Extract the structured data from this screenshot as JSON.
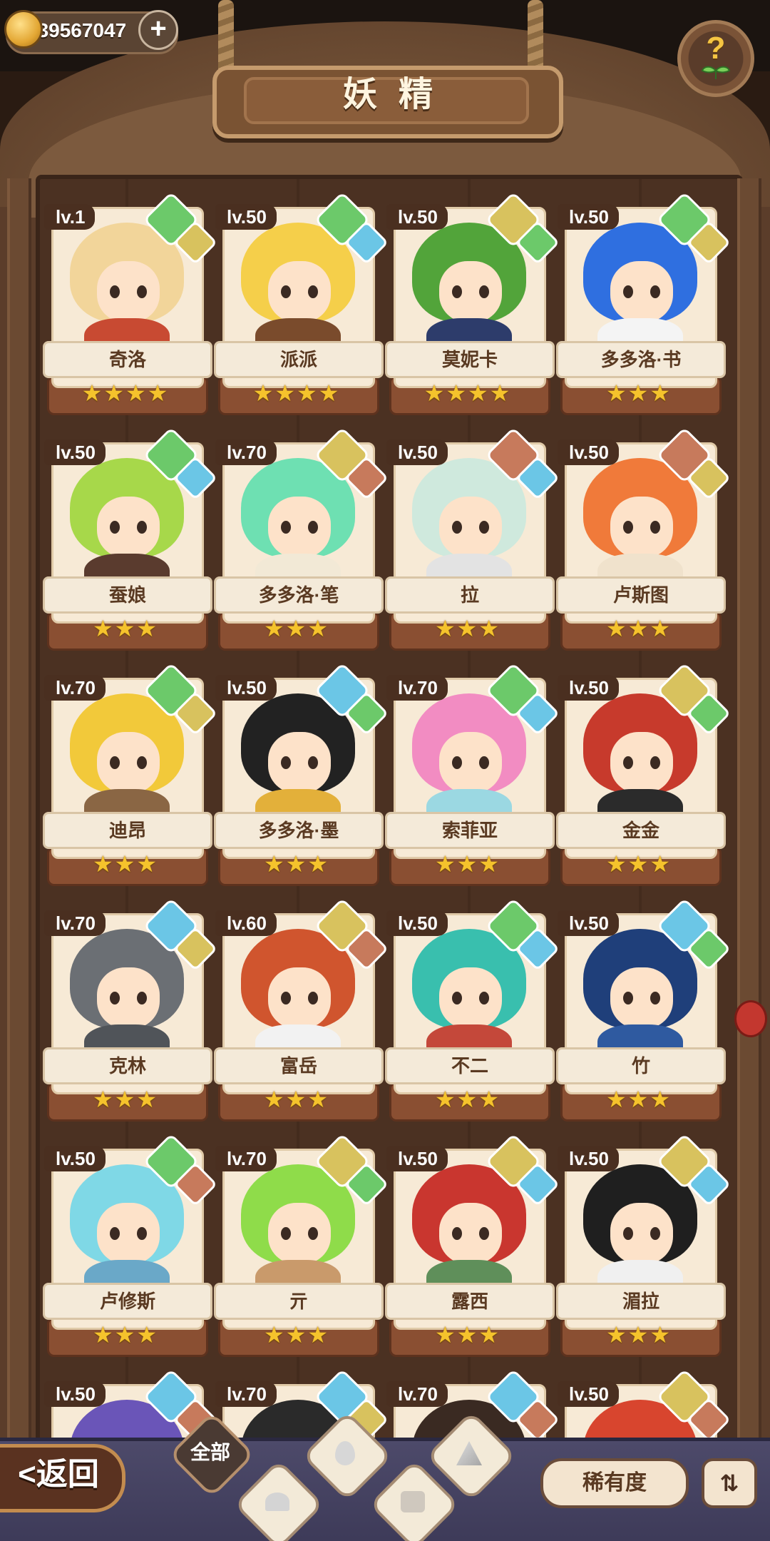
{
  "currency": {
    "amount": "239567047",
    "add_label": "+"
  },
  "help": {
    "label": "?"
  },
  "header": {
    "title": "妖精"
  },
  "cards": [
    {
      "level": "lv.1",
      "name": "奇洛",
      "stars": "★★★★",
      "hair": "#f2d59a",
      "body": "#c84a32",
      "elem1": "green",
      "elem2": "earth"
    },
    {
      "level": "lv.50",
      "name": "派派",
      "stars": "★★★★",
      "hair": "#f5cf4a",
      "body": "#7a4b2c",
      "elem1": "green",
      "elem2": "water"
    },
    {
      "level": "lv.50",
      "name": "莫妮卡",
      "stars": "★★★★",
      "hair": "#52a43a",
      "body": "#2d3c6b",
      "elem1": "earth",
      "elem2": "green"
    },
    {
      "level": "lv.50",
      "name": "多多洛·书",
      "stars": "★★★",
      "hair": "#2f6fe0",
      "body": "#f4f4f4",
      "elem1": "green",
      "elem2": "earth"
    },
    {
      "level": "lv.50",
      "name": "蚕娘",
      "stars": "★★★",
      "hair": "#a7d84a",
      "body": "#5a3b2e",
      "elem1": "green",
      "elem2": "water"
    },
    {
      "level": "lv.70",
      "name": "多多洛·笔",
      "stars": "★★★",
      "hair": "#6ee0b2",
      "body": "#f2e9d6",
      "elem1": "earth",
      "elem2": "fire"
    },
    {
      "level": "lv.50",
      "name": "拉",
      "stars": "★★★",
      "hair": "#cfe9dd",
      "body": "#e3e3e3",
      "elem1": "fire",
      "elem2": "water"
    },
    {
      "level": "lv.50",
      "name": "卢斯图",
      "stars": "★★★",
      "hair": "#f07a3a",
      "body": "#f0e2cc",
      "elem1": "fire",
      "elem2": "earth"
    },
    {
      "level": "lv.70",
      "name": "迪昂",
      "stars": "★★★",
      "hair": "#f2c93a",
      "body": "#8a6644",
      "elem1": "green",
      "elem2": "earth"
    },
    {
      "level": "lv.50",
      "name": "多多洛·墨",
      "stars": "★★★",
      "hair": "#222222",
      "body": "#e3b03a",
      "elem1": "water",
      "elem2": "green"
    },
    {
      "level": "lv.70",
      "name": "索菲亚",
      "stars": "★★★",
      "hair": "#f28cc2",
      "body": "#9bd8e2",
      "elem1": "green",
      "elem2": "water"
    },
    {
      "level": "lv.50",
      "name": "金金",
      "stars": "★★★",
      "hair": "#c73a2c",
      "body": "#2b2b2b",
      "elem1": "earth",
      "elem2": "green"
    },
    {
      "level": "lv.70",
      "name": "克林",
      "stars": "★★★",
      "hair": "#6b6f74",
      "body": "#505459",
      "elem1": "water",
      "elem2": "earth"
    },
    {
      "level": "lv.60",
      "name": "富岳",
      "stars": "★★★",
      "hair": "#d0552e",
      "body": "#f2f2f2",
      "elem1": "earth",
      "elem2": "fire"
    },
    {
      "level": "lv.50",
      "name": "不二",
      "stars": "★★★",
      "hair": "#39bfae",
      "body": "#c4483a",
      "elem1": "green",
      "elem2": "water"
    },
    {
      "level": "lv.50",
      "name": "竹",
      "stars": "★★★",
      "hair": "#1f3f7a",
      "body": "#2f5aa0",
      "elem1": "water",
      "elem2": "green"
    },
    {
      "level": "lv.50",
      "name": "卢修斯",
      "stars": "★★★",
      "hair": "#7fd8e6",
      "body": "#6aa8c8",
      "elem1": "green",
      "elem2": "fire"
    },
    {
      "level": "lv.70",
      "name": "亓",
      "stars": "★★★",
      "hair": "#8fdc4a",
      "body": "#c99a6b",
      "elem1": "earth",
      "elem2": "green"
    },
    {
      "level": "lv.50",
      "name": "露西",
      "stars": "★★★",
      "hair": "#c9362f",
      "body": "#5f8f5a",
      "elem1": "earth",
      "elem2": "water"
    },
    {
      "level": "lv.50",
      "name": "湄拉",
      "stars": "★★★",
      "hair": "#1f1f1f",
      "body": "#f0f0f0",
      "elem1": "earth",
      "elem2": "water"
    },
    {
      "level": "lv.50",
      "name": "",
      "stars": "",
      "hair": "#6a55b8",
      "body": "#6a55b8",
      "elem1": "water",
      "elem2": "fire"
    },
    {
      "level": "lv.70",
      "name": "",
      "stars": "",
      "hair": "#2a2a2a",
      "body": "#2a2a2a",
      "elem1": "water",
      "elem2": "earth"
    },
    {
      "level": "lv.70",
      "name": "",
      "stars": "",
      "hair": "#3a2a22",
      "body": "#3a2a22",
      "elem1": "water",
      "elem2": "fire"
    },
    {
      "level": "lv.50",
      "name": "",
      "stars": "",
      "hair": "#d8452e",
      "body": "#d8452e",
      "elem1": "earth",
      "elem2": "fire"
    }
  ],
  "bottom": {
    "back_label": "<返回",
    "filter_all_label": "全部",
    "filters": [
      "water-icon",
      "green-icon",
      "earth-icon",
      "fire-icon"
    ],
    "rarity_label": "稀有度",
    "sort_label": "⇅"
  },
  "colors": {
    "green": "#6cc96a",
    "earth": "#d8c25e",
    "water": "#6bc6e6",
    "fire": "#c77a5c"
  }
}
